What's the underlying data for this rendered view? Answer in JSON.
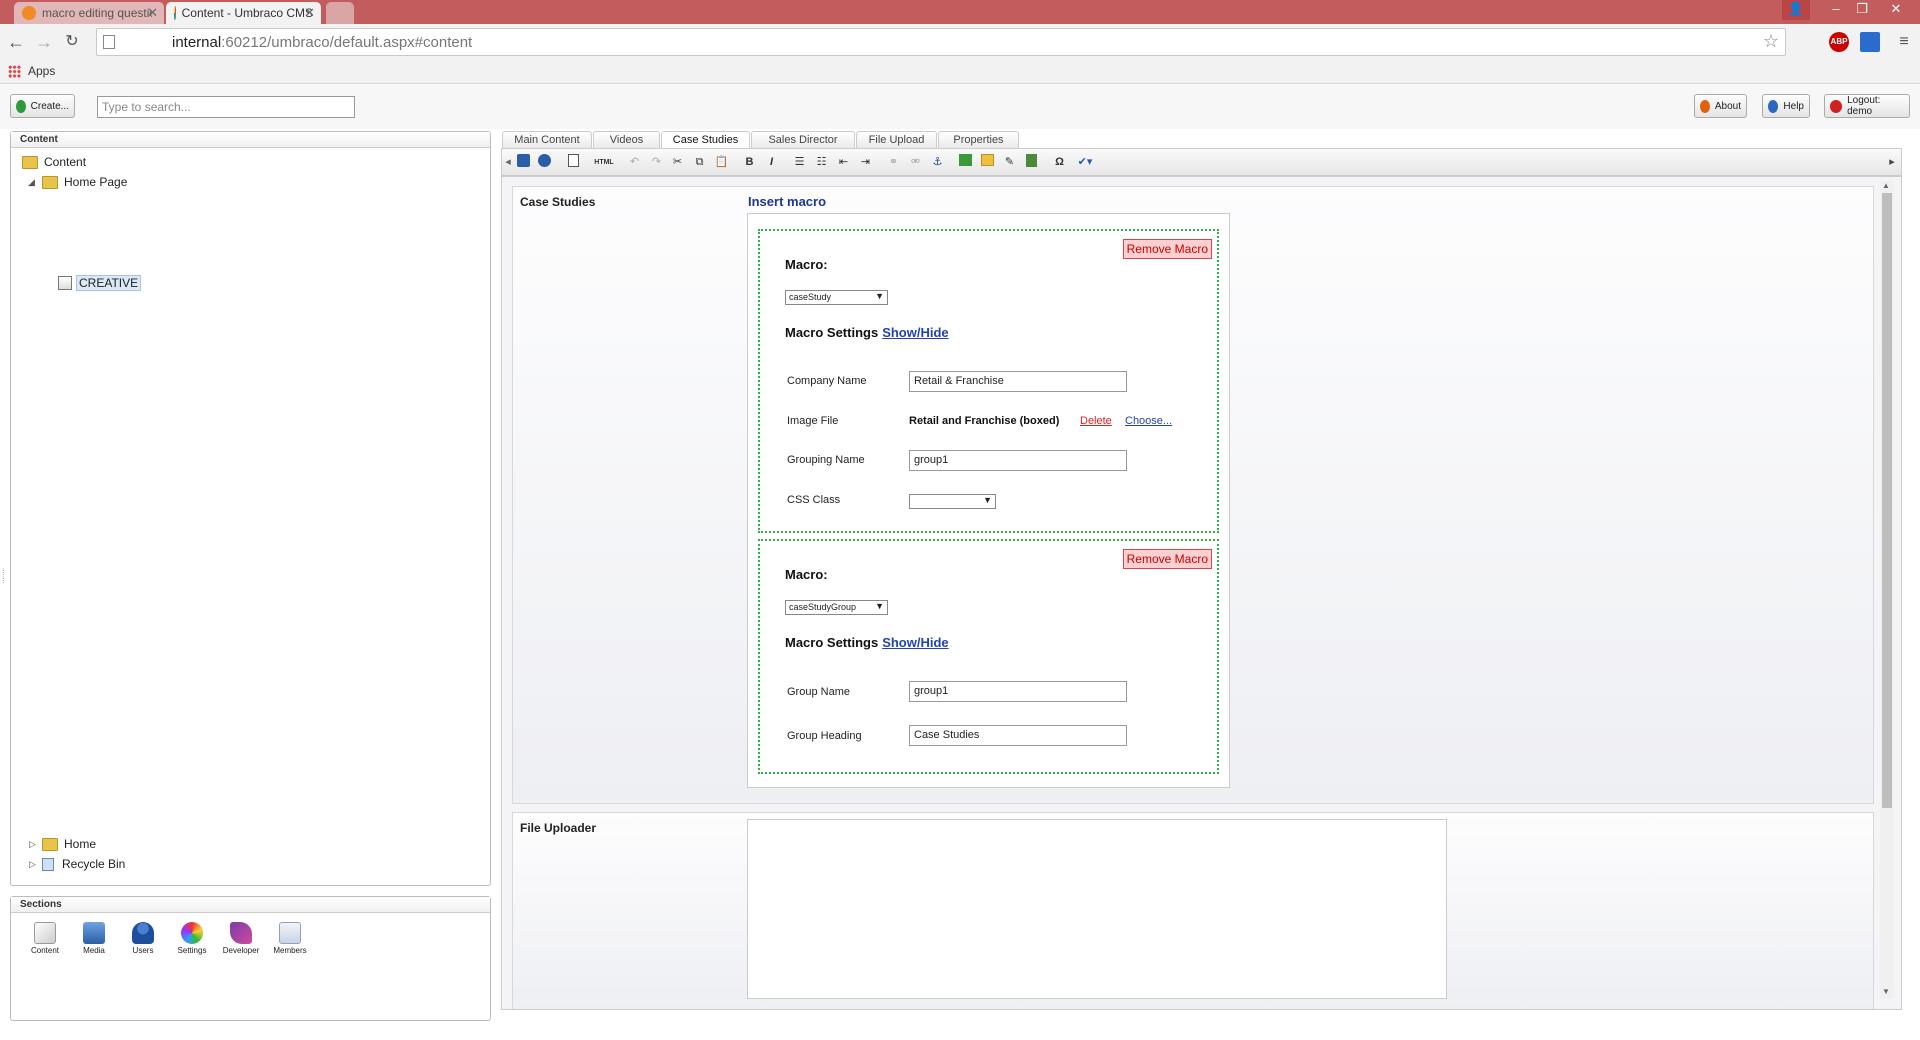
{
  "browser": {
    "tabs": [
      {
        "title": "macro editing question in"
      },
      {
        "title": "Content - Umbraco CMS"
      }
    ],
    "url_host": "internal",
    "url_rest": ":60212/umbraco/default.aspx#content",
    "bookmarks_label": "Apps",
    "abp_label": "ABP"
  },
  "header": {
    "create_label": "Create...",
    "search_placeholder": "Type to search...",
    "about_label": "About",
    "help_label": "Help",
    "logout_label": "Logout: demo"
  },
  "content_panel": {
    "title": "Content",
    "tree": {
      "root": "Content",
      "home_page": "Home Page",
      "creative": "CREATIVE",
      "home": "Home",
      "recycle_bin": "Recycle Bin"
    }
  },
  "sections_panel": {
    "title": "Sections",
    "items": [
      "Content",
      "Media",
      "Users",
      "Settings",
      "Developer",
      "Members"
    ]
  },
  "editor": {
    "tabs": [
      "Main Content",
      "Videos",
      "Case Studies",
      "Sales Director",
      "File Upload",
      "Properties"
    ],
    "active_tab": "Case Studies",
    "toolbar": {
      "html_label": "HTML",
      "bold": "B",
      "italic": "I",
      "omega": "Ω"
    },
    "case_studies": {
      "label": "Case Studies",
      "insert_macro": "Insert macro",
      "macro1": {
        "remove_label": "Remove Macro",
        "macro_label": "Macro:",
        "macro_value": "caseStudy",
        "settings_label": "Macro Settings",
        "show_hide": "Show/Hide",
        "company_name_label": "Company Name",
        "company_name_value": "Retail & Franchise",
        "image_file_label": "Image File",
        "image_file_value": "Retail and Franchise (boxed)",
        "delete_label": "Delete",
        "choose_label": "Choose...",
        "grouping_name_label": "Grouping Name",
        "grouping_name_value": "group1",
        "css_class_label": "CSS Class",
        "css_class_value": ""
      },
      "macro2": {
        "remove_label": "Remove Macro",
        "macro_label": "Macro:",
        "macro_value": "caseStudyGroup",
        "settings_label": "Macro Settings",
        "show_hide": "Show/Hide",
        "group_name_label": "Group Name",
        "group_name_value": "group1",
        "group_heading_label": "Group Heading",
        "group_heading_value": "Case Studies"
      }
    },
    "file_uploader": {
      "label": "File Uploader"
    }
  }
}
